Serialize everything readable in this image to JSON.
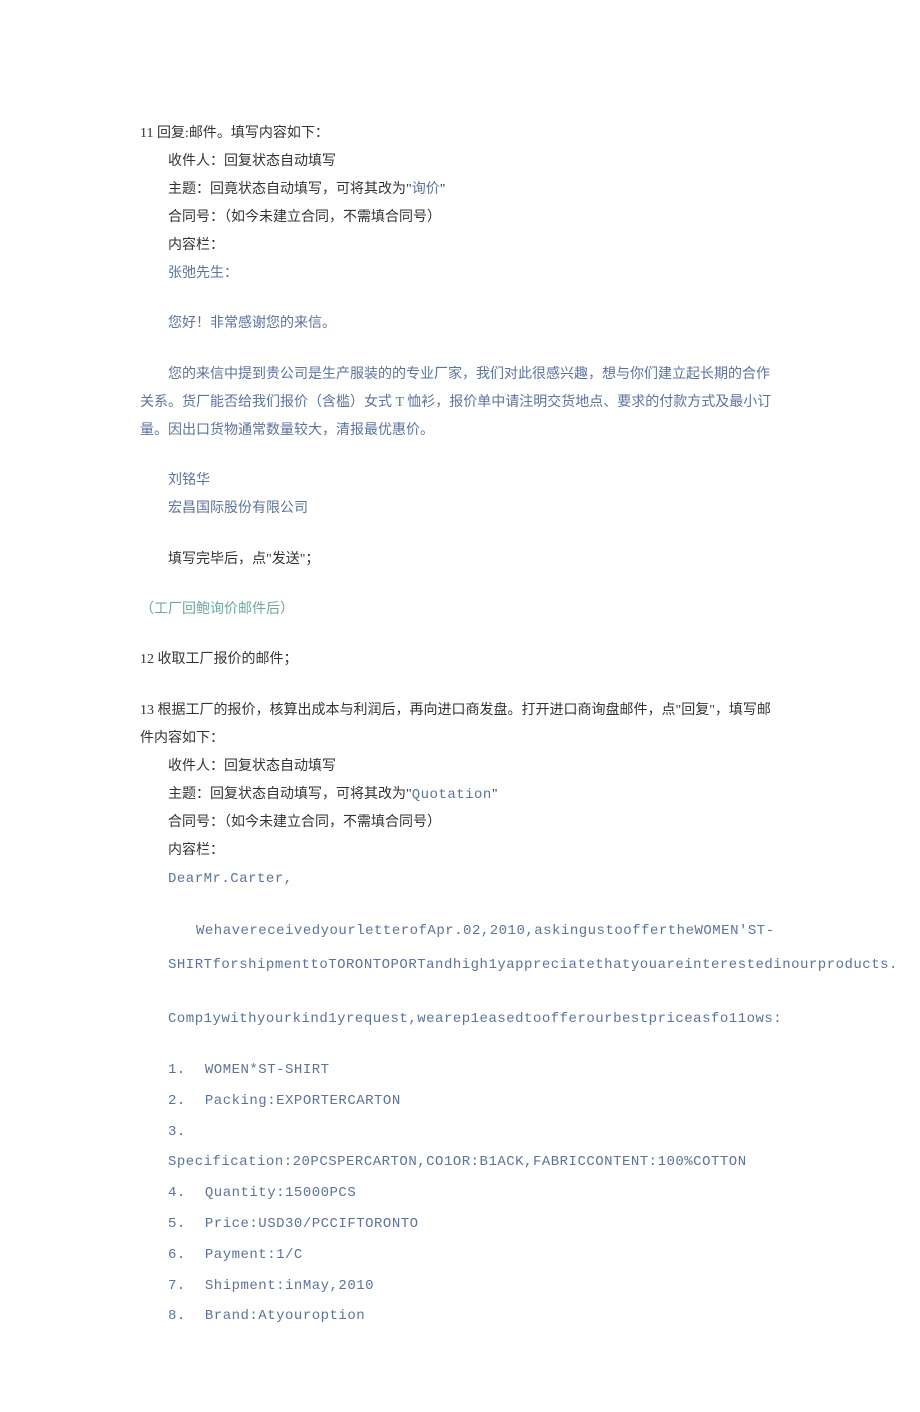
{
  "s11": {
    "header": "11 回复:邮件。填写内容如下：",
    "recipient": "收件人：回复状态自动填写",
    "subject_prefix": "主题：回竟状态自动填写，可将其改为\"",
    "subject_value": "询价",
    "subject_suffix": "\"",
    "contract": "合同号：（如今未建立合同，不需填合同号）",
    "content_label": "内容栏：",
    "greet": "张弛先生：",
    "line1": "您好！非常感谢您的来信。",
    "body": "您的来信中提到贵公司是生产服装的的专业厂家，我们对此很感兴趣，想与你们建立起长期的合作关系。货厂能否给我们报价（含槛）女式 T 恤衫，报价单中请注明交货地点、要求的付款方式及最小订量。因出口货物通常数量较大，清报最优惠价。",
    "sign_name": "刘铭华",
    "sign_company": "宏昌国际股份有限公司",
    "after_fill": "填写完毕后，点\"发送\"；"
  },
  "factory_note": "（工厂回鲍询价邮件后）",
  "s12": {
    "header": "12 收取工厂报价的邮件；"
  },
  "s13": {
    "header": "13 根据工厂的报价，核算出成本与利润后，再向进口商发盘。打开进口商询盘邮件，点\"回复\"，填写邮件内容如下：",
    "recipient": "收件人：回复状态自动填写",
    "subject_prefix": "主题：回复状态自动填写，可将其改为\"",
    "subject_value": "Quotation",
    "subject_suffix": "\"",
    "contract": "合同号：（如今未建立合同，不需填合同号）",
    "content_label": "内容栏：",
    "dear": "DearMr.Carter,",
    "p1": "WehavereceivedyourletterofApr.02,2010,askingustooffertheWOMEN'ST-SHIRTforshipmenttoTORONTOPORTandhigh1yappreciatethatyouareinterestedinourproducts.",
    "p2": "Comp1ywithyourkind1yrequest,wearep1easedtoofferourbestpriceasfo11ows:",
    "items": [
      "WOMEN*ST-SHIRT",
      "Packing:EXPORTERCARTON",
      "Specification:20PCSPERCARTON,CO1OR:B1ACK,FABRICCONTENT:100%COTTON",
      "Quantity:15000PCS",
      "Price:USD30/PCCIFTORONTO",
      "Payment:1/C",
      "Shipment:inMay,2010",
      "Brand:Atyouroption"
    ]
  }
}
